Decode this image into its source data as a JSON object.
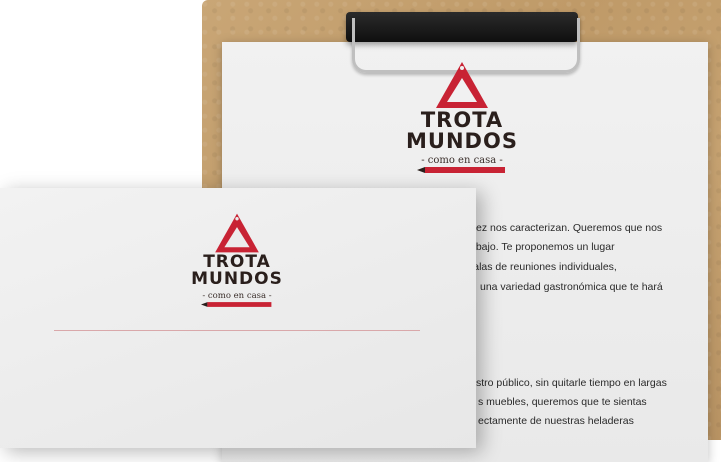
{
  "brand": {
    "line1": "TROTA",
    "line2": "MUNDOS",
    "tagline": "- como en casa -",
    "colors": {
      "red": "#c82334",
      "dark": "#2a1f1c"
    }
  },
  "back_paragraphs": {
    "p1": [
      "ez nos caracterizan. Queremos que nos",
      "abajo. Te proponemos un lugar",
      "salas de reuniones individuales,",
      "una variedad gastronómica que te hará"
    ],
    "p2": [
      "stro público, sin quitarle tiempo en largas",
      "s muebles, queremos que te sientas",
      "ectamente de nuestras heladeras"
    ]
  },
  "icons": [
    "triangle-logo-icon",
    "pencil-icon",
    "clipboard-clip-icon"
  ]
}
